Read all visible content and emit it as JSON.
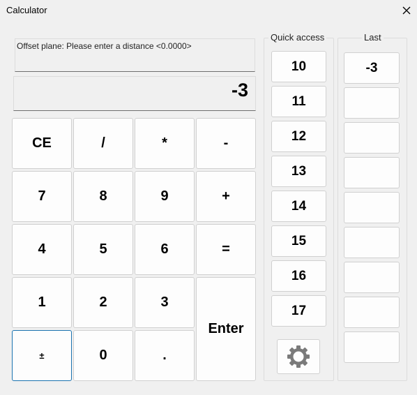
{
  "window": {
    "title": "Calculator"
  },
  "prompt": "Offset plane: Please enter a distance  <0.0000>",
  "display": "-3",
  "keys": {
    "ce": "CE",
    "divide": "/",
    "multiply": "*",
    "minus": "-",
    "k7": "7",
    "k8": "8",
    "k9": "9",
    "plus": "+",
    "k4": "4",
    "k5": "5",
    "k6": "6",
    "equals": "=",
    "k1": "1",
    "k2": "2",
    "k3": "3",
    "enter": "Enter",
    "plusminus": "±",
    "k0": "0",
    "dot": "."
  },
  "quick_access": {
    "label": "Quick access",
    "items": [
      "10",
      "11",
      "12",
      "13",
      "14",
      "15",
      "16",
      "17"
    ]
  },
  "last": {
    "label": "Last",
    "items": [
      "-3",
      "",
      "",
      "",
      "",
      "",
      "",
      "",
      ""
    ]
  },
  "icons": {
    "close": "close-icon",
    "settings": "gear-icon"
  }
}
